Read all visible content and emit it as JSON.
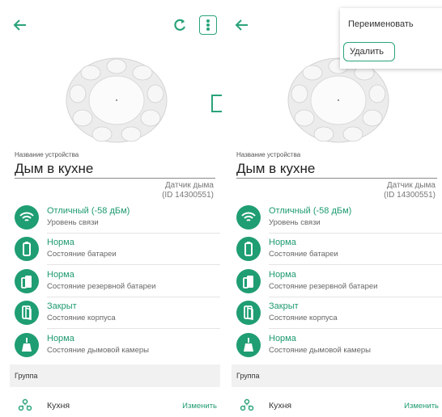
{
  "device": {
    "name_label": "Название устройства",
    "name": "Дым в кухне",
    "type_line1": "Датчик дыма",
    "type_line2": "(ID 14300551)"
  },
  "status_rows": [
    {
      "title": "Отличный (-58 дБм)",
      "subtitle": "Уровень связи",
      "icon": "wifi-icon"
    },
    {
      "title": "Норма",
      "subtitle": "Состояние батареи",
      "icon": "battery-icon"
    },
    {
      "title": "Норма",
      "subtitle": "Состояние резервной батареи",
      "icon": "backup-battery-icon"
    },
    {
      "title": "Закрыт",
      "subtitle": "Состояние корпуса",
      "icon": "casing-icon"
    },
    {
      "title": "Норма",
      "subtitle": "Состояние дымовой камеры",
      "icon": "smoke-chamber-icon"
    }
  ],
  "group": {
    "header": "Группа",
    "name": "Кухня",
    "edit_label": "Изменить"
  },
  "menu": {
    "rename_label": "Переименовать",
    "delete_label": "Удалить"
  },
  "colors": {
    "accent": "#1f9d73"
  }
}
